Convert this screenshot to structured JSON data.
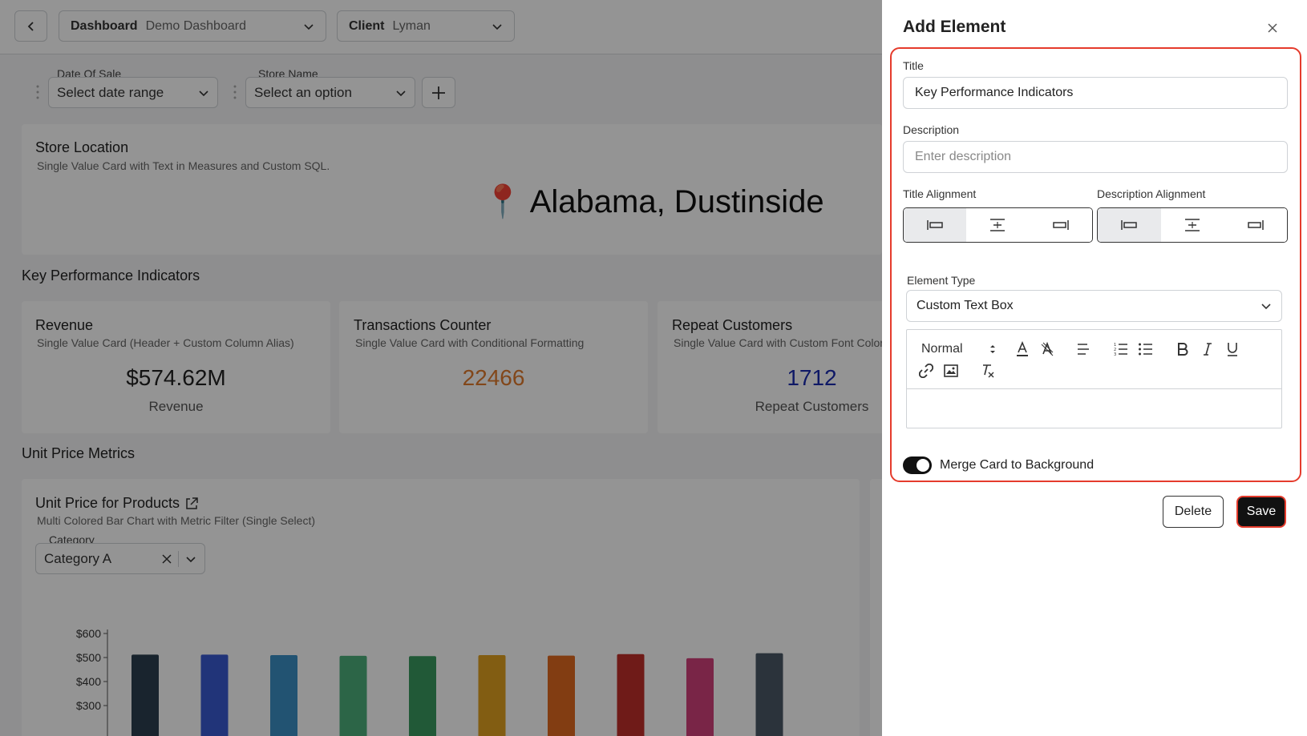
{
  "header": {
    "dashboard_label": "Dashboard",
    "dashboard_value": "Demo Dashboard",
    "client_label": "Client",
    "client_value": "Lyman"
  },
  "filters": [
    {
      "label": "Date Of Sale",
      "value": "Select date range"
    },
    {
      "label": "Store Name",
      "value": "Select an option"
    }
  ],
  "store_card": {
    "title": "Store Location",
    "subtitle": "Single Value Card with Text in Measures and Custom SQL.",
    "value": "📍 Alabama, Dustinside"
  },
  "kpi_section": {
    "title": "Key Performance Indicators",
    "cards": [
      {
        "title": "Revenue",
        "subtitle": "Single Value Card (Header + Custom Column Alias)",
        "value": "$574.62M",
        "label": "Revenue",
        "color": "#222222"
      },
      {
        "title": "Transactions Counter",
        "subtitle": "Single Value Card with Conditional Formatting",
        "value": "22466",
        "label": "",
        "color": "#e07a2e"
      },
      {
        "title": "Repeat Customers",
        "subtitle": "Single Value Card with Custom Font Color",
        "value": "1712",
        "label": "Repeat Customers",
        "color": "#1a2bb0"
      }
    ]
  },
  "unit_price_section": {
    "title": "Unit Price Metrics",
    "card_title": "Unit Price for Products",
    "card_subtitle": "Multi Colored Bar Chart with Metric Filter (Single Select)",
    "category_label": "Category",
    "category_value": "Category A"
  },
  "chart_data": {
    "type": "bar",
    "title": "",
    "xlabel": "",
    "ylabel": "",
    "ylim": [
      200,
      600
    ],
    "y_ticks": [
      "$600",
      "$500",
      "$400",
      "$300"
    ],
    "y_tick_values": [
      600,
      500,
      400,
      300
    ],
    "values": [
      512,
      512,
      510,
      507,
      506,
      510,
      508,
      514,
      497,
      518
    ],
    "colors": [
      "#2c3e50",
      "#3a5bd0",
      "#3b8fc4",
      "#4caf7a",
      "#3a9a60",
      "#e0a020",
      "#e06a20",
      "#c0302a",
      "#d0407a",
      "#4a5866"
    ]
  },
  "drawer": {
    "title": "Add Element",
    "title_label": "Title",
    "title_value": "Key Performance Indicators",
    "description_label": "Description",
    "description_placeholder": "Enter description",
    "title_alignment_label": "Title Alignment",
    "description_alignment_label": "Description Alignment",
    "element_type_label": "Element Type",
    "element_type_value": "Custom Text Box",
    "editor_heading_select": "Normal",
    "toggle_label": "Merge Card to Background",
    "delete_label": "Delete",
    "save_label": "Save"
  }
}
